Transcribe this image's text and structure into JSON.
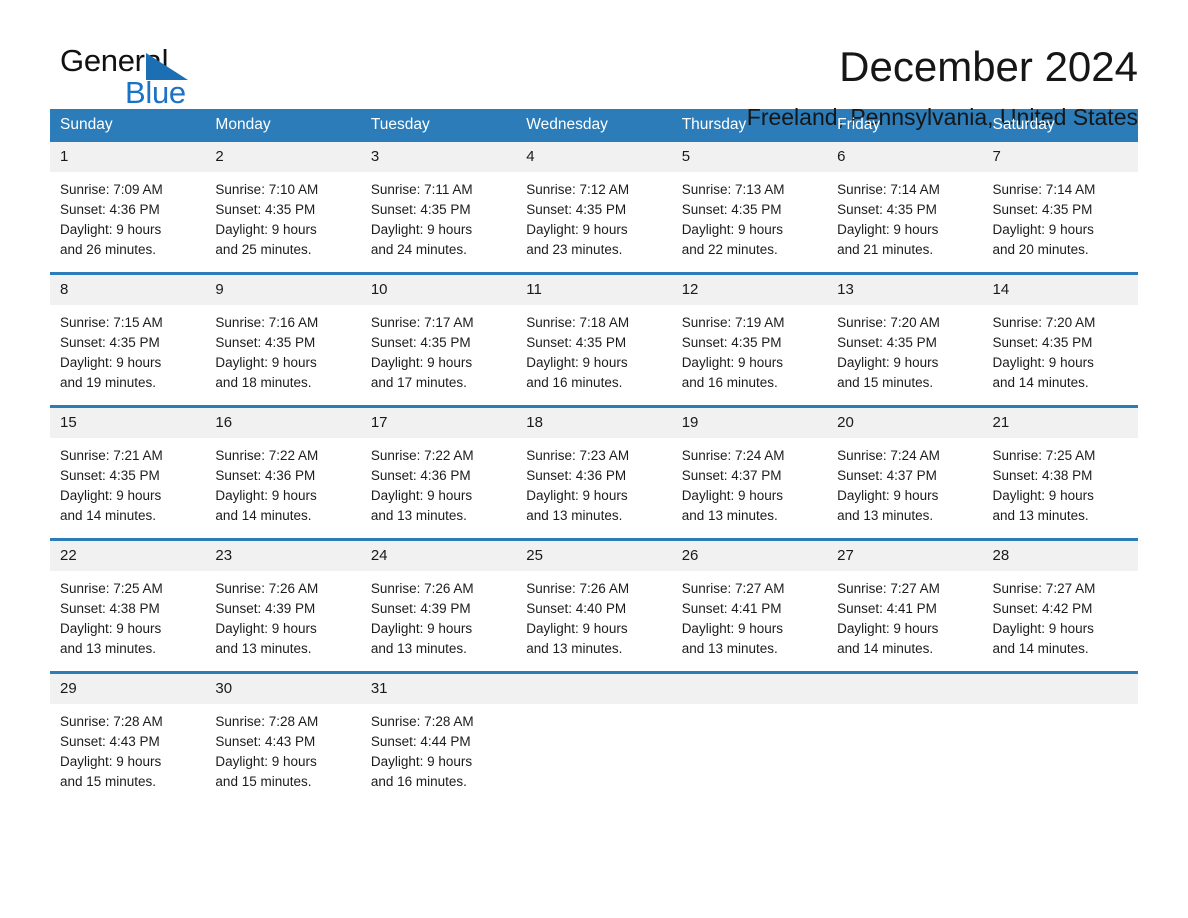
{
  "brand": {
    "name_part1": "General",
    "name_part2": "Blue",
    "triangle_color": "#1c6fb3",
    "blue_text_color": "#1a73c4"
  },
  "header": {
    "title": "December 2024",
    "subtitle": "Freeland, Pennsylvania, United States"
  },
  "theme": {
    "header_blue": "#2b7cb8",
    "row_divider_blue": "#2b7cb8",
    "daynum_band": "#f1f1f1",
    "page_background": "#ffffff"
  },
  "calendar": {
    "day_headers": [
      "Sunday",
      "Monday",
      "Tuesday",
      "Wednesday",
      "Thursday",
      "Friday",
      "Saturday"
    ],
    "weeks": [
      [
        {
          "day": "1",
          "sunrise": "Sunrise: 7:09 AM",
          "sunset": "Sunset: 4:36 PM",
          "daylight_line1": "Daylight: 9 hours",
          "daylight_line2": "and 26 minutes."
        },
        {
          "day": "2",
          "sunrise": "Sunrise: 7:10 AM",
          "sunset": "Sunset: 4:35 PM",
          "daylight_line1": "Daylight: 9 hours",
          "daylight_line2": "and 25 minutes."
        },
        {
          "day": "3",
          "sunrise": "Sunrise: 7:11 AM",
          "sunset": "Sunset: 4:35 PM",
          "daylight_line1": "Daylight: 9 hours",
          "daylight_line2": "and 24 minutes."
        },
        {
          "day": "4",
          "sunrise": "Sunrise: 7:12 AM",
          "sunset": "Sunset: 4:35 PM",
          "daylight_line1": "Daylight: 9 hours",
          "daylight_line2": "and 23 minutes."
        },
        {
          "day": "5",
          "sunrise": "Sunrise: 7:13 AM",
          "sunset": "Sunset: 4:35 PM",
          "daylight_line1": "Daylight: 9 hours",
          "daylight_line2": "and 22 minutes."
        },
        {
          "day": "6",
          "sunrise": "Sunrise: 7:14 AM",
          "sunset": "Sunset: 4:35 PM",
          "daylight_line1": "Daylight: 9 hours",
          "daylight_line2": "and 21 minutes."
        },
        {
          "day": "7",
          "sunrise": "Sunrise: 7:14 AM",
          "sunset": "Sunset: 4:35 PM",
          "daylight_line1": "Daylight: 9 hours",
          "daylight_line2": "and 20 minutes."
        }
      ],
      [
        {
          "day": "8",
          "sunrise": "Sunrise: 7:15 AM",
          "sunset": "Sunset: 4:35 PM",
          "daylight_line1": "Daylight: 9 hours",
          "daylight_line2": "and 19 minutes."
        },
        {
          "day": "9",
          "sunrise": "Sunrise: 7:16 AM",
          "sunset": "Sunset: 4:35 PM",
          "daylight_line1": "Daylight: 9 hours",
          "daylight_line2": "and 18 minutes."
        },
        {
          "day": "10",
          "sunrise": "Sunrise: 7:17 AM",
          "sunset": "Sunset: 4:35 PM",
          "daylight_line1": "Daylight: 9 hours",
          "daylight_line2": "and 17 minutes."
        },
        {
          "day": "11",
          "sunrise": "Sunrise: 7:18 AM",
          "sunset": "Sunset: 4:35 PM",
          "daylight_line1": "Daylight: 9 hours",
          "daylight_line2": "and 16 minutes."
        },
        {
          "day": "12",
          "sunrise": "Sunrise: 7:19 AM",
          "sunset": "Sunset: 4:35 PM",
          "daylight_line1": "Daylight: 9 hours",
          "daylight_line2": "and 16 minutes."
        },
        {
          "day": "13",
          "sunrise": "Sunrise: 7:20 AM",
          "sunset": "Sunset: 4:35 PM",
          "daylight_line1": "Daylight: 9 hours",
          "daylight_line2": "and 15 minutes."
        },
        {
          "day": "14",
          "sunrise": "Sunrise: 7:20 AM",
          "sunset": "Sunset: 4:35 PM",
          "daylight_line1": "Daylight: 9 hours",
          "daylight_line2": "and 14 minutes."
        }
      ],
      [
        {
          "day": "15",
          "sunrise": "Sunrise: 7:21 AM",
          "sunset": "Sunset: 4:35 PM",
          "daylight_line1": "Daylight: 9 hours",
          "daylight_line2": "and 14 minutes."
        },
        {
          "day": "16",
          "sunrise": "Sunrise: 7:22 AM",
          "sunset": "Sunset: 4:36 PM",
          "daylight_line1": "Daylight: 9 hours",
          "daylight_line2": "and 14 minutes."
        },
        {
          "day": "17",
          "sunrise": "Sunrise: 7:22 AM",
          "sunset": "Sunset: 4:36 PM",
          "daylight_line1": "Daylight: 9 hours",
          "daylight_line2": "and 13 minutes."
        },
        {
          "day": "18",
          "sunrise": "Sunrise: 7:23 AM",
          "sunset": "Sunset: 4:36 PM",
          "daylight_line1": "Daylight: 9 hours",
          "daylight_line2": "and 13 minutes."
        },
        {
          "day": "19",
          "sunrise": "Sunrise: 7:24 AM",
          "sunset": "Sunset: 4:37 PM",
          "daylight_line1": "Daylight: 9 hours",
          "daylight_line2": "and 13 minutes."
        },
        {
          "day": "20",
          "sunrise": "Sunrise: 7:24 AM",
          "sunset": "Sunset: 4:37 PM",
          "daylight_line1": "Daylight: 9 hours",
          "daylight_line2": "and 13 minutes."
        },
        {
          "day": "21",
          "sunrise": "Sunrise: 7:25 AM",
          "sunset": "Sunset: 4:38 PM",
          "daylight_line1": "Daylight: 9 hours",
          "daylight_line2": "and 13 minutes."
        }
      ],
      [
        {
          "day": "22",
          "sunrise": "Sunrise: 7:25 AM",
          "sunset": "Sunset: 4:38 PM",
          "daylight_line1": "Daylight: 9 hours",
          "daylight_line2": "and 13 minutes."
        },
        {
          "day": "23",
          "sunrise": "Sunrise: 7:26 AM",
          "sunset": "Sunset: 4:39 PM",
          "daylight_line1": "Daylight: 9 hours",
          "daylight_line2": "and 13 minutes."
        },
        {
          "day": "24",
          "sunrise": "Sunrise: 7:26 AM",
          "sunset": "Sunset: 4:39 PM",
          "daylight_line1": "Daylight: 9 hours",
          "daylight_line2": "and 13 minutes."
        },
        {
          "day": "25",
          "sunrise": "Sunrise: 7:26 AM",
          "sunset": "Sunset: 4:40 PM",
          "daylight_line1": "Daylight: 9 hours",
          "daylight_line2": "and 13 minutes."
        },
        {
          "day": "26",
          "sunrise": "Sunrise: 7:27 AM",
          "sunset": "Sunset: 4:41 PM",
          "daylight_line1": "Daylight: 9 hours",
          "daylight_line2": "and 13 minutes."
        },
        {
          "day": "27",
          "sunrise": "Sunrise: 7:27 AM",
          "sunset": "Sunset: 4:41 PM",
          "daylight_line1": "Daylight: 9 hours",
          "daylight_line2": "and 14 minutes."
        },
        {
          "day": "28",
          "sunrise": "Sunrise: 7:27 AM",
          "sunset": "Sunset: 4:42 PM",
          "daylight_line1": "Daylight: 9 hours",
          "daylight_line2": "and 14 minutes."
        }
      ],
      [
        {
          "day": "29",
          "sunrise": "Sunrise: 7:28 AM",
          "sunset": "Sunset: 4:43 PM",
          "daylight_line1": "Daylight: 9 hours",
          "daylight_line2": "and 15 minutes."
        },
        {
          "day": "30",
          "sunrise": "Sunrise: 7:28 AM",
          "sunset": "Sunset: 4:43 PM",
          "daylight_line1": "Daylight: 9 hours",
          "daylight_line2": "and 15 minutes."
        },
        {
          "day": "31",
          "sunrise": "Sunrise: 7:28 AM",
          "sunset": "Sunset: 4:44 PM",
          "daylight_line1": "Daylight: 9 hours",
          "daylight_line2": "and 16 minutes."
        },
        {
          "day": "",
          "sunrise": "",
          "sunset": "",
          "daylight_line1": "",
          "daylight_line2": ""
        },
        {
          "day": "",
          "sunrise": "",
          "sunset": "",
          "daylight_line1": "",
          "daylight_line2": ""
        },
        {
          "day": "",
          "sunrise": "",
          "sunset": "",
          "daylight_line1": "",
          "daylight_line2": ""
        },
        {
          "day": "",
          "sunrise": "",
          "sunset": "",
          "daylight_line1": "",
          "daylight_line2": ""
        }
      ]
    ]
  }
}
